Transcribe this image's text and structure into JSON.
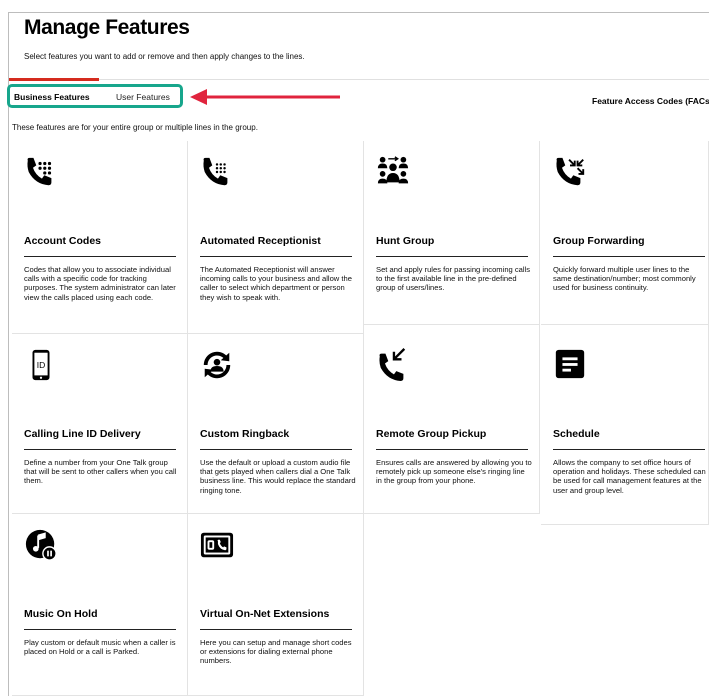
{
  "page": {
    "title": "Manage Features",
    "subtitle": "Select features you want to add or remove and then apply changes to the lines."
  },
  "tabs": {
    "business": "Business Features",
    "user": "User Features",
    "fac": "Feature Access Codes (FACs"
  },
  "section_description": "These features are for your entire group or multiple lines in the group.",
  "features": [
    {
      "name": "Account Codes",
      "icon": "phone-keypad-icon",
      "description": "Codes that allow you to associate individual calls with a specific code for tracking purposes. The system administrator can later view the calls placed using each code."
    },
    {
      "name": "Automated Receptionist",
      "icon": "phone-dialpad-icon",
      "description": "The Automated Receptionist will answer incoming calls to your business and allow the caller to select which department or person they wish to speak with."
    },
    {
      "name": "Hunt Group",
      "icon": "group-users-icon",
      "description": "Set and apply rules for passing incoming calls to the first available line in the pre-defined group of users/lines."
    },
    {
      "name": "Group Forwarding",
      "icon": "call-forwarding-icon",
      "description": "Quickly forward multiple user lines to the same destination/number; most commonly used for business continuity."
    },
    {
      "name": "Calling Line ID Delivery",
      "icon": "caller-id-icon",
      "description": "Define a number from your One Talk group that will be sent to other callers when you call them."
    },
    {
      "name": "Custom Ringback",
      "icon": "ringback-refresh-icon",
      "description": "Use the default or upload a custom audio file that gets played when callers dial a One Talk business line. This would replace the standard ringing tone."
    },
    {
      "name": "Remote Group Pickup",
      "icon": "call-pickup-icon",
      "description": "Ensures calls are answered by allowing you to remotely pick up someone else's ringing line in the group from your phone."
    },
    {
      "name": "Schedule",
      "icon": "schedule-icon",
      "description": "Allows the company to set office hours of operation and holidays. These scheduled can be used for call management features at the user and group level."
    },
    {
      "name": "Music On Hold",
      "icon": "music-hold-icon",
      "description": "Play custom or default music when a caller is placed on Hold or a call is Parked."
    },
    {
      "name": "Virtual On-Net Extensions",
      "icon": "virtual-extensions-icon",
      "description": "Here you can setup and manage short codes or extensions for dialing external phone numbers."
    }
  ],
  "colors": {
    "accent_red": "#d52b1e",
    "highlight_teal": "#17a68c",
    "arrow_red": "#e0243d"
  }
}
